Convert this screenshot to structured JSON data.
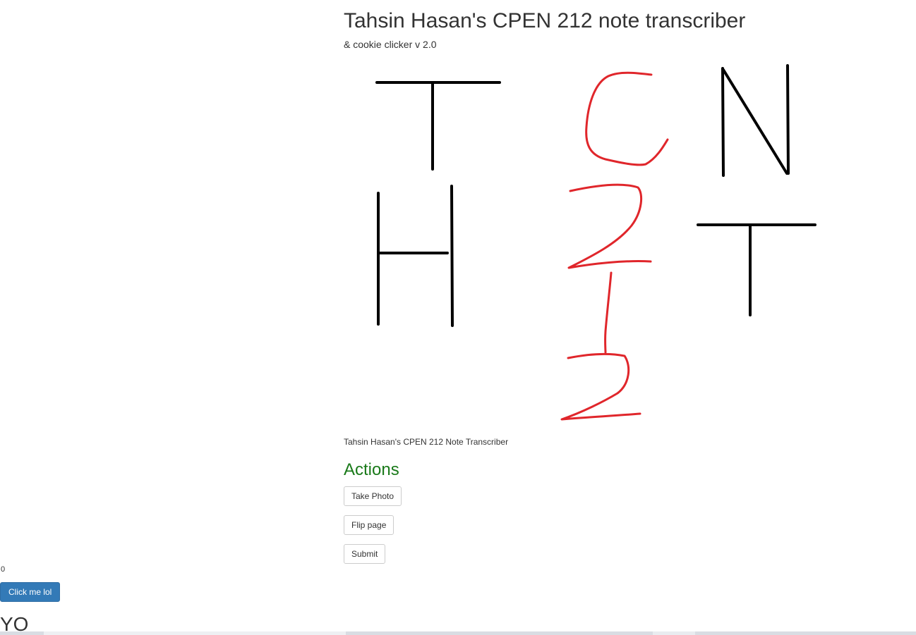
{
  "header": {
    "title": "Tahsin Hasan's CPEN 212 note transcriber",
    "subtitle": "& cookie clicker v 2.0"
  },
  "drawing": {
    "black_letters": [
      "T",
      "H",
      "N",
      "T"
    ],
    "red_text": "C212",
    "black_color": "#000000",
    "red_color": "#e0262b"
  },
  "caption": "Tahsin Hasan's CPEN 212 Note Transcriber",
  "actions": {
    "heading": "Actions",
    "heading_color": "#1a7a1a",
    "buttons": [
      {
        "label": "Take Photo"
      },
      {
        "label": "Flip page"
      },
      {
        "label": "Submit"
      }
    ]
  },
  "cookie_clicker": {
    "count": "0",
    "button_label": "Click me lol",
    "button_color": "#337ab7"
  },
  "footer": {
    "text": "YO"
  }
}
